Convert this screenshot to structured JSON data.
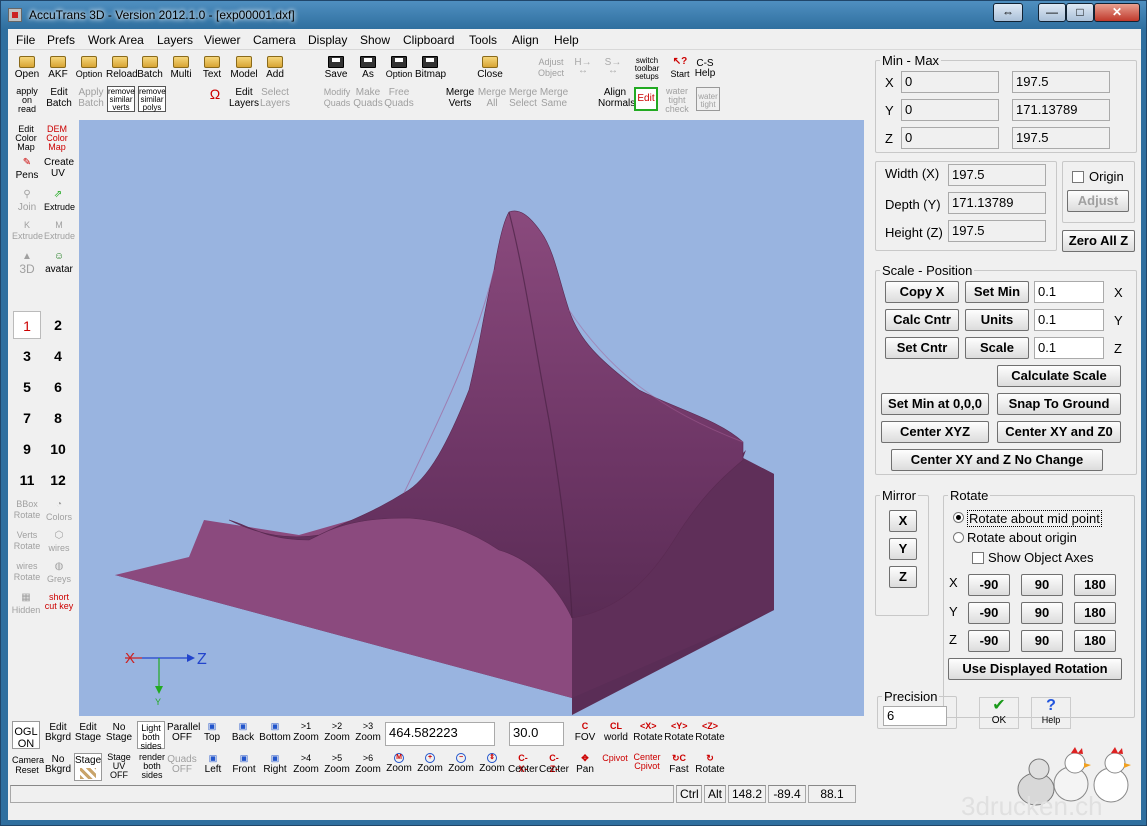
{
  "window": {
    "title": "AccuTrans 3D - Version 2012.1.0 - [exp00001.dxf]",
    "restore_label": "⇔",
    "minimize_label": "—",
    "maximize_label": "□",
    "close_label": "✕"
  },
  "menu": [
    "File",
    "Prefs",
    "Work Area",
    "Layers",
    "Viewer",
    "Camera",
    "Display",
    "Show",
    "Clipboard",
    "Tools",
    "Align",
    "Help"
  ],
  "toolbar": {
    "row1": [
      {
        "label": "Open",
        "icon": "folder-icon",
        "enabled": true
      },
      {
        "label": "AKF",
        "icon": "folder-icon",
        "enabled": true
      },
      {
        "label": "Option",
        "icon": "folder-icon",
        "enabled": true
      },
      {
        "label": "Reload",
        "icon": "folder-icon",
        "enabled": true
      },
      {
        "label": "Batch",
        "icon": "folder-icon",
        "enabled": true
      },
      {
        "label": "Multi",
        "icon": "folder-icon",
        "enabled": true
      },
      {
        "label": "Text",
        "icon": "folder-icon",
        "enabled": true
      },
      {
        "label": "Model",
        "icon": "folder-icon",
        "enabled": true
      },
      {
        "label": "Add",
        "icon": "folder-icon",
        "enabled": true
      },
      {
        "label": "Save",
        "icon": "disk-icon",
        "enabled": true
      },
      {
        "label": "As",
        "icon": "disk-icon",
        "enabled": true
      },
      {
        "label": "Option",
        "icon": "disk-icon",
        "enabled": true
      },
      {
        "label": "Bitmap",
        "icon": "disk-icon",
        "enabled": true
      },
      {
        "label": "Close",
        "icon": "folder-icon",
        "enabled": true
      }
    ],
    "adjust_object": "Adjust Object",
    "switch_toolbar": "switch toolbar setups",
    "start": "Start",
    "cs_help": "C-S Help",
    "apply_on_read": "apply on read",
    "edit_batch": "Edit Batch",
    "apply_batch": "Apply Batch",
    "remove_similar_verts": "remove similar verts",
    "remove_similar_polys": "remove similar polys",
    "edit_layers": "Edit Layers",
    "select_layers": "Select Layers",
    "modify_quads": "Modify Quads",
    "make_quads": "Make Quads",
    "free_quads": "Free Quads",
    "merge_verts": "Merge Verts",
    "merge_all": "Merge All",
    "merge_select": "Merge Select",
    "merge_same": "Merge Same",
    "align_normals": "Align Normals",
    "edit": "Edit",
    "water_tight_check": "water tight check",
    "water_tight": "water tight"
  },
  "sidebar": {
    "edit_color_map": "Edit Color Map",
    "dem_color_map": "DEM Color Map",
    "pens": "Pens",
    "create_uv": "Create UV",
    "join": "Join",
    "extrude": "Extrude",
    "k_extrude": "K Extrude",
    "m_extrude": "M Extrude",
    "to_3d": "3D",
    "avatar": "avatar",
    "numbers": [
      "1",
      "2",
      "3",
      "4",
      "5",
      "6",
      "7",
      "8",
      "9",
      "10",
      "11",
      "12"
    ],
    "bbox_rotate": "BBox Rotate",
    "colors": "Colors",
    "verts_rotate": "Verts Rotate",
    "wires": "wires",
    "wires_rotate": "wires Rotate",
    "greys": "Greys",
    "hidden": "Hidden",
    "short_cut_key": "short cut key"
  },
  "viewport": {
    "axis_x": "X",
    "axis_z": "Z",
    "axis_y": "Y",
    "background": "#99b4e0",
    "model_color": "#8a4a7d"
  },
  "minmax": {
    "legend": "Min - Max",
    "rows": [
      {
        "axis": "X",
        "min": "0",
        "max": "197.5"
      },
      {
        "axis": "Y",
        "min": "0",
        "max": "171.13789"
      },
      {
        "axis": "Z",
        "min": "0",
        "max": "197.5"
      }
    ]
  },
  "dims": {
    "width_label": "Width (X)",
    "width": "197.5",
    "depth_label": "Depth (Y)",
    "depth": "171.13789",
    "height_label": "Height (Z)",
    "height": "197.5",
    "origin_label": "Origin",
    "adjust_label": "Adjust",
    "zero_all_label": "Zero All Z"
  },
  "scale": {
    "legend": "Scale - Position",
    "copy_x": "Copy X",
    "set_min": "Set Min",
    "calc_cntr": "Calc Cntr",
    "units": "Units",
    "set_cntr": "Set Cntr",
    "scale": "Scale",
    "x_value": "0.1",
    "y_value": "0.1",
    "z_value": "0.1",
    "x": "X",
    "y": "Y",
    "z": "Z",
    "calculate_scale": "Calculate Scale",
    "set_min_at_000": "Set Min at 0,0,0",
    "snap_to_ground": "Snap To Ground",
    "center_xyz": "Center XYZ",
    "center_xy_z0": "Center XY and Z0",
    "center_xy_z_no_change": "Center XY and Z No Change"
  },
  "mirror": {
    "legend": "Mirror",
    "x": "X",
    "y": "Y",
    "z": "Z"
  },
  "rotate": {
    "legend": "Rotate",
    "about_mid": "Rotate about mid point",
    "about_origin": "Rotate about origin",
    "show_axes": "Show Object Axes",
    "rows": [
      {
        "axis": "X",
        "b1": "-90",
        "b2": "90",
        "b3": "180"
      },
      {
        "axis": "Y",
        "b1": "-90",
        "b2": "90",
        "b3": "180"
      },
      {
        "axis": "Z",
        "b1": "-90",
        "b2": "90",
        "b3": "180"
      }
    ],
    "use_displayed": "Use Displayed Rotation"
  },
  "precision": {
    "legend": "Precision",
    "value": "6"
  },
  "ok_label": "OK",
  "help_label": "Help",
  "watermark": "3drucken.ch",
  "bottom": {
    "ogl_on": "OGL ON",
    "edit_bkgrd": "Edit Bkgrd",
    "edit_stage": "Edit Stage",
    "no_stage": "No Stage",
    "light_both_sides": "Light both sides",
    "parallel_off": "Parallel OFF",
    "top": "Top",
    "back": "Back",
    "bottom": "Bottom",
    "zoom_1": "Zoom",
    "zoom_2": "Zoom",
    "zoom_3": "Zoom",
    "zoom_1_tag": ">1",
    "zoom_2_tag": ">2",
    "zoom_3_tag": ">3",
    "zoom_value": "464.582223",
    "fov_value": "30.0",
    "fov": "FOV",
    "world": "world",
    "rotate_x": "Rotate",
    "rotate_y": "Rotate",
    "rotate_z": "Rotate",
    "rot_x_tag": "<X>",
    "rot_y_tag": "<Y>",
    "rot_z_tag": "<Z>",
    "camera_reset": "Camera Reset",
    "no_bkgrd": "No Bkgrd",
    "stage": "Stage",
    "stage_uv_off": "Stage UV OFF",
    "render_both_sides": "render both sides",
    "quads_off": "Quads OFF",
    "left": "Left",
    "front": "Front",
    "right": "Right",
    "zoom_4": "Zoom",
    "zoom_5": "Zoom",
    "zoom_6": "Zoom",
    "zoom_4_tag": ">4",
    "zoom_5_tag": ">5",
    "zoom_6_tag": ">6",
    "zoom_m": "Zoom",
    "zoom_in": "Zoom",
    "zoom_out": "Zoom",
    "zoom_fit": "Zoom",
    "center_x": "Center",
    "center_z": "Center",
    "center_x_tag": "C-X-",
    "center_z_tag": "C-Z-",
    "pan": "Pan",
    "c_pivot": "Cpivot",
    "center_pivot": "Center Cpivot",
    "fast": "Fast",
    "rotate_c": "Rotate"
  },
  "status": {
    "ctrl": "Ctrl",
    "alt": "Alt",
    "v1": "148.2",
    "v2": "-89.4",
    "v3": "88.1"
  }
}
